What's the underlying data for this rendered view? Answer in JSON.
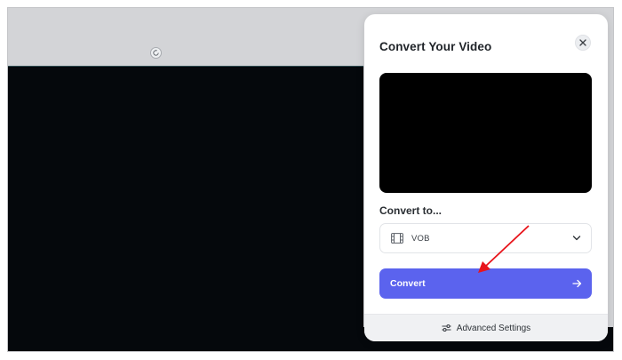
{
  "dialog": {
    "title": "Convert Your Video",
    "close_icon": "close-icon",
    "convert_to_label": "Convert to...",
    "format": {
      "selected": "VOB",
      "icon": "film-icon",
      "dropdown_icon": "chevron-down-icon"
    },
    "convert_button": {
      "label": "Convert",
      "icon": "arrow-right-icon",
      "color": "#5b63ee"
    },
    "advanced_settings": {
      "label": "Advanced Settings",
      "icon": "sliders-icon"
    }
  },
  "canvas": {
    "rotate_icon": "rotate-icon",
    "background": "#05080c"
  },
  "annotation": {
    "arrow_color": "#e8141b"
  }
}
